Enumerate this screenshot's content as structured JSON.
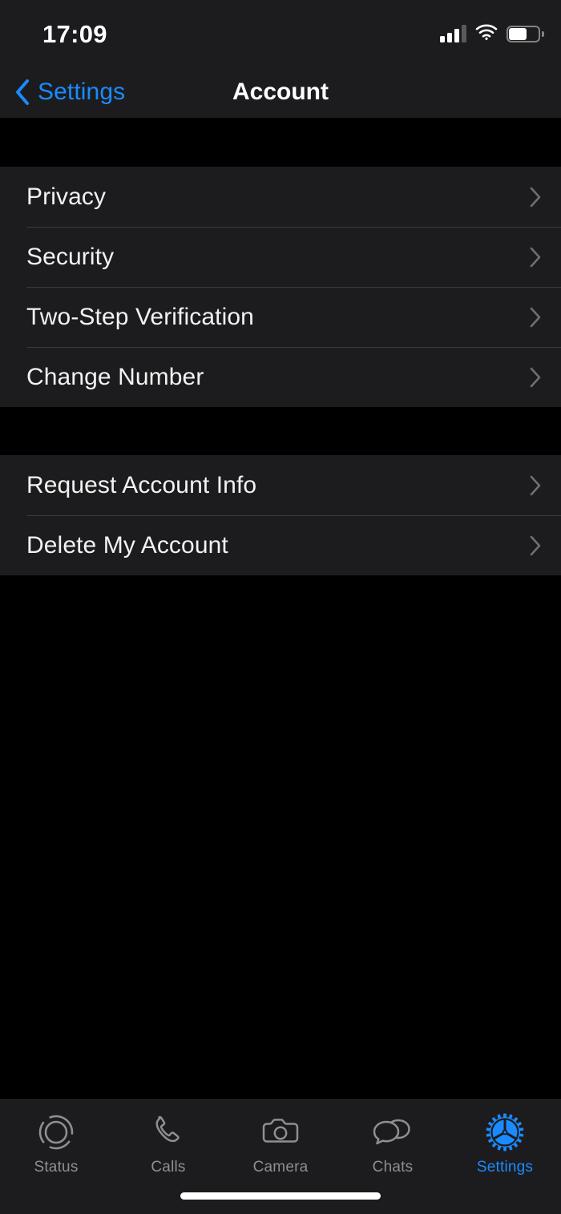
{
  "status_bar": {
    "time": "17:09",
    "cellular_icon": "cellular-signal-icon",
    "cellular_bars_filled": 3,
    "cellular_bars_total": 4,
    "wifi_icon": "wifi-icon",
    "battery_icon": "battery-icon",
    "battery_level_percent": 62
  },
  "nav_bar": {
    "back_label": "Settings",
    "back_icon": "chevron-left-icon",
    "title": "Account"
  },
  "colors": {
    "accent": "#1b8aff",
    "background": "#000000",
    "surface": "#1c1c1e",
    "separator": "#3a3a3c",
    "text_primary": "#f2f2f2",
    "text_secondary": "#8e8e93",
    "chevron": "#6e6e73"
  },
  "groups": [
    {
      "rows": [
        {
          "label": "Privacy",
          "accessory_icon": "chevron-right-icon"
        },
        {
          "label": "Security",
          "accessory_icon": "chevron-right-icon"
        },
        {
          "label": "Two-Step Verification",
          "accessory_icon": "chevron-right-icon"
        },
        {
          "label": "Change Number",
          "accessory_icon": "chevron-right-icon"
        }
      ]
    },
    {
      "rows": [
        {
          "label": "Request Account Info",
          "accessory_icon": "chevron-right-icon"
        },
        {
          "label": "Delete My Account",
          "accessory_icon": "chevron-right-icon"
        }
      ]
    }
  ],
  "tab_bar": {
    "items": [
      {
        "label": "Status",
        "icon": "status-ring-icon",
        "active": false
      },
      {
        "label": "Calls",
        "icon": "phone-icon",
        "active": false
      },
      {
        "label": "Camera",
        "icon": "camera-icon",
        "active": false
      },
      {
        "label": "Chats",
        "icon": "chat-bubbles-icon",
        "active": false
      },
      {
        "label": "Settings",
        "icon": "gear-icon",
        "active": true
      }
    ]
  },
  "home_indicator": "home-indicator-bar"
}
